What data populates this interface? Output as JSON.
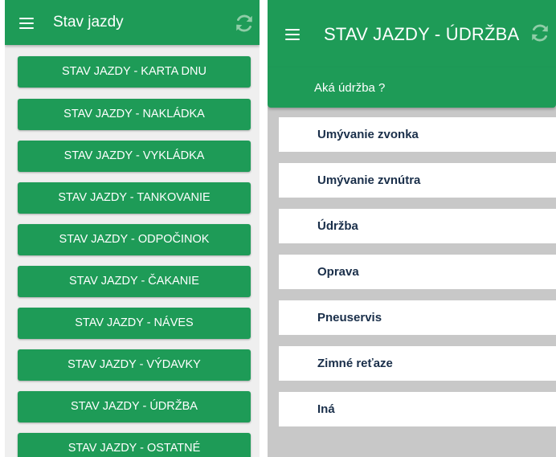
{
  "colors": {
    "primary_green": "#1e9b57",
    "left_background": "#efefef",
    "right_background": "#c8c8c8",
    "list_text": "#1a2f4a",
    "refresh_icon": "#8fcda7"
  },
  "left_screen": {
    "title": "Stav jazdy",
    "menu_icon": "hamburger-icon",
    "refresh_icon": "refresh-icon",
    "buttons": [
      "STAV JAZDY - KARTA DNU",
      "STAV JAZDY - NAKLÁDKA",
      "STAV JAZDY - VYKLÁDKA",
      "STAV JAZDY - TANKOVANIE",
      "STAV JAZDY - ODPOČINOK",
      "STAV JAZDY - ČAKANIE",
      "STAV JAZDY - NÁVES",
      "STAV JAZDY - VÝDAVKY",
      "STAV JAZDY - ÚDRŽBA",
      "STAV JAZDY - OSTATNÉ"
    ]
  },
  "right_screen": {
    "title": "STAV JAZDY - ÚDRŽBA",
    "menu_icon": "hamburger-icon",
    "refresh_icon": "refresh-icon",
    "question": "Aká údržba ?",
    "options": [
      "Umývanie zvonka",
      "Umývanie zvnútra",
      "Údržba",
      "Oprava",
      "Pneuservis",
      "Zimné reťaze",
      "Iná"
    ]
  }
}
